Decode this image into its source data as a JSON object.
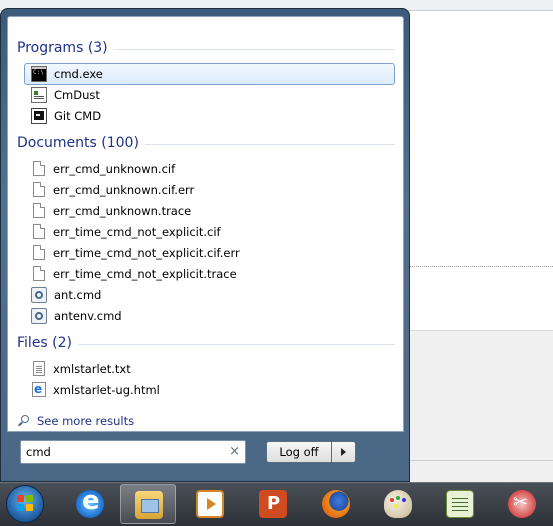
{
  "start_menu": {
    "groups": [
      {
        "title": "Programs (3)",
        "items": [
          {
            "label": "cmd.exe",
            "icon": "cmd-icon",
            "selected": true
          },
          {
            "label": "CmDust",
            "icon": "cmddust-icon"
          },
          {
            "label": "Git CMD",
            "icon": "git-cmd-icon"
          }
        ]
      },
      {
        "title": "Documents (100)",
        "items": [
          {
            "label": "err_cmd_unknown.cif",
            "icon": "document-icon"
          },
          {
            "label": "err_cmd_unknown.cif.err",
            "icon": "document-icon"
          },
          {
            "label": "err_cmd_unknown.trace",
            "icon": "document-icon"
          },
          {
            "label": "err_time_cmd_not_explicit.cif",
            "icon": "document-icon"
          },
          {
            "label": "err_time_cmd_not_explicit.cif.err",
            "icon": "document-icon"
          },
          {
            "label": "err_time_cmd_not_explicit.trace",
            "icon": "document-icon"
          },
          {
            "label": "ant.cmd",
            "icon": "script-gear-icon"
          },
          {
            "label": "antenv.cmd",
            "icon": "script-gear-icon"
          }
        ]
      },
      {
        "title": "Files (2)",
        "items": [
          {
            "label": "xmlstarlet.txt",
            "icon": "text-file-icon"
          },
          {
            "label": "xmlstarlet-ug.html",
            "icon": "html-file-icon"
          }
        ]
      }
    ],
    "see_more": "See more results",
    "search": {
      "value": "cmd",
      "clear_glyph": "×"
    },
    "power": {
      "label": "Log off"
    }
  },
  "taskbar": {
    "start_button": "windows-start-orb-icon",
    "pinned": [
      {
        "icon": "internet-explorer-icon"
      },
      {
        "icon": "windows-explorer-icon",
        "active": true
      },
      {
        "icon": "media-player-icon"
      },
      {
        "icon": "powerpoint-icon"
      },
      {
        "icon": "firefox-icon"
      },
      {
        "icon": "paint-icon"
      },
      {
        "icon": "notepad-plus-icon"
      },
      {
        "icon": "snipping-tool-icon"
      }
    ]
  },
  "colors": {
    "group_title": "#1e3287",
    "menu_frame": "#4a6785",
    "selection_border": "#7da2ce",
    "taskbar": "#2d3137"
  }
}
